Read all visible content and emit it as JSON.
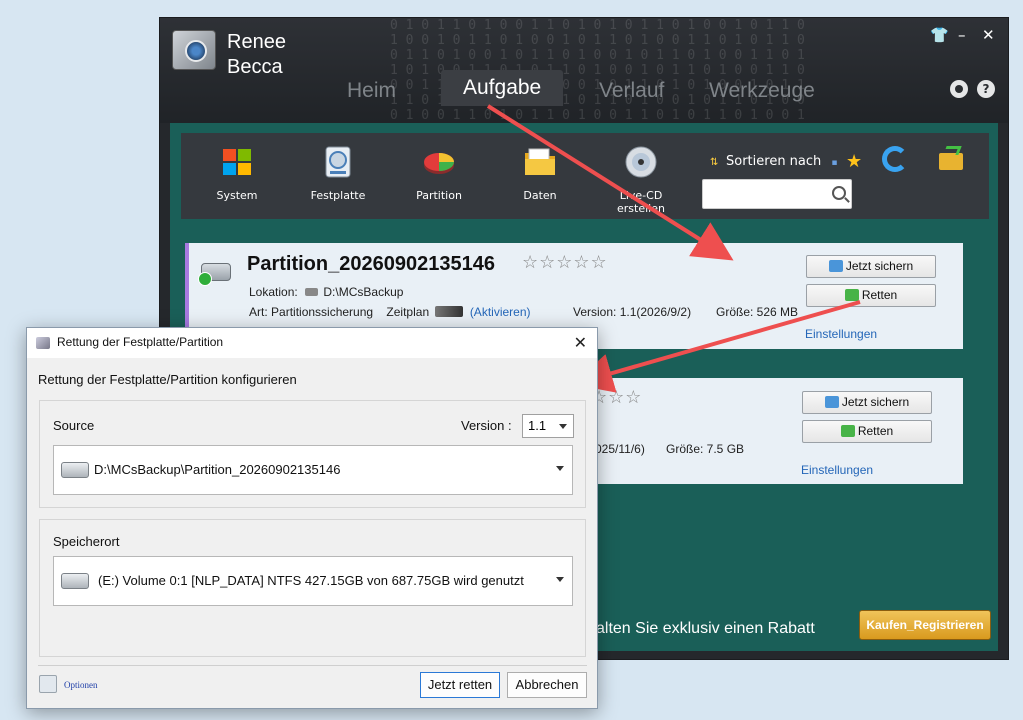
{
  "app": {
    "brand": [
      "Renee",
      "Becca"
    ],
    "window_controls": {
      "shirt": "👕",
      "minimize": "–",
      "close": "✕"
    },
    "nav_tabs": [
      "Heim",
      "Aufgabe",
      "Verlauf",
      "Werkzeuge"
    ],
    "active_tab": "Aufgabe",
    "help_label": "?",
    "toolbar": {
      "items": [
        "System",
        "Festplatte",
        "Partition",
        "Daten",
        "Live-CD erstellen"
      ],
      "sort_label": "Sortieren nach",
      "search_placeholder": ""
    },
    "tasks": [
      {
        "title": "Partition_20260902135146",
        "rating_stars": "☆☆☆☆☆",
        "location_label": "Lokation:",
        "location_value": "D:\\MCsBackup",
        "type_label": "Art:",
        "type_value": "Partitionssicherung",
        "schedule_label": "Zeitplan",
        "schedule_link": "(Aktivieren)",
        "version": "Version: 1.1(2026/9/2)",
        "size": "Größe: 526 MB",
        "backup_button": "Jetzt sichern",
        "restore_button": "Retten",
        "settings_link": "Einstellungen"
      },
      {
        "rating_stars": "☆☆☆",
        "version_fragment": "025/11/6)",
        "size": "Größe: 7.5 GB",
        "backup_button": "Jetzt sichern",
        "restore_button": "Retten",
        "settings_link": "Einstellungen"
      }
    ],
    "promo_fragment": "alten Sie exklusiv einen Rabatt",
    "buy_button": "Kaufen_Registrieren"
  },
  "dialog": {
    "title": "Rettung der Festplatte/Partition",
    "close": "✕",
    "heading": "Rettung der Festplatte/Partition konfigurieren",
    "source": {
      "label": "Source",
      "version_label": "Version :",
      "version_value": "1.1",
      "path": "D:\\MCsBackup\\Partition_20260902135146"
    },
    "destination": {
      "label": "Speicherort",
      "value": "(E:) Volume 0:1 [NLP_DATA] NTFS   427.15GB von 687.75GB wird genutzt"
    },
    "options_link": "Optionen",
    "restore_button": "Jetzt retten",
    "cancel_button": "Abbrechen"
  },
  "colors": {
    "accent_arrow": "#ee4f4f",
    "teal_panel": "#1a5f58",
    "buy_gold": "#e2aa35",
    "link_blue": "#2466b8"
  }
}
